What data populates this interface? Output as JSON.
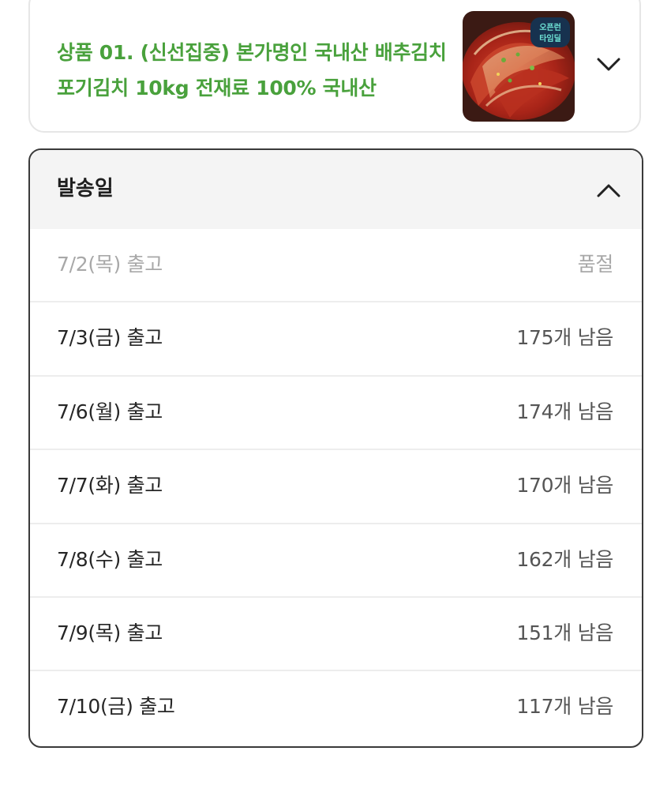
{
  "product": {
    "title": "상품 01. (신선집중) 본가명인 국내산 배추김치 포기김치 10kg 전재료 100% 국내산",
    "thumbnail_badge": "오픈런 타임딜",
    "expand_icon": "chevron-down-icon"
  },
  "colors": {
    "accent_green": "#49a13c",
    "sold_out_gray": "#a8a8a8",
    "header_bg": "#f4f4f4"
  },
  "option_panel": {
    "title": "발송일",
    "collapse_icon": "chevron-up-icon",
    "options": [
      {
        "date": "7/2(목) 출고",
        "stock": "품절",
        "sold_out": true
      },
      {
        "date": "7/3(금) 출고",
        "stock": "175개 남음",
        "sold_out": false
      },
      {
        "date": "7/6(월) 출고",
        "stock": "174개 남음",
        "sold_out": false
      },
      {
        "date": "7/7(화) 출고",
        "stock": "170개 남음",
        "sold_out": false
      },
      {
        "date": "7/8(수) 출고",
        "stock": "162개 남음",
        "sold_out": false
      },
      {
        "date": "7/9(목) 출고",
        "stock": "151개 남음",
        "sold_out": false
      },
      {
        "date": "7/10(금) 출고",
        "stock": "117개 남음",
        "sold_out": false
      }
    ]
  }
}
